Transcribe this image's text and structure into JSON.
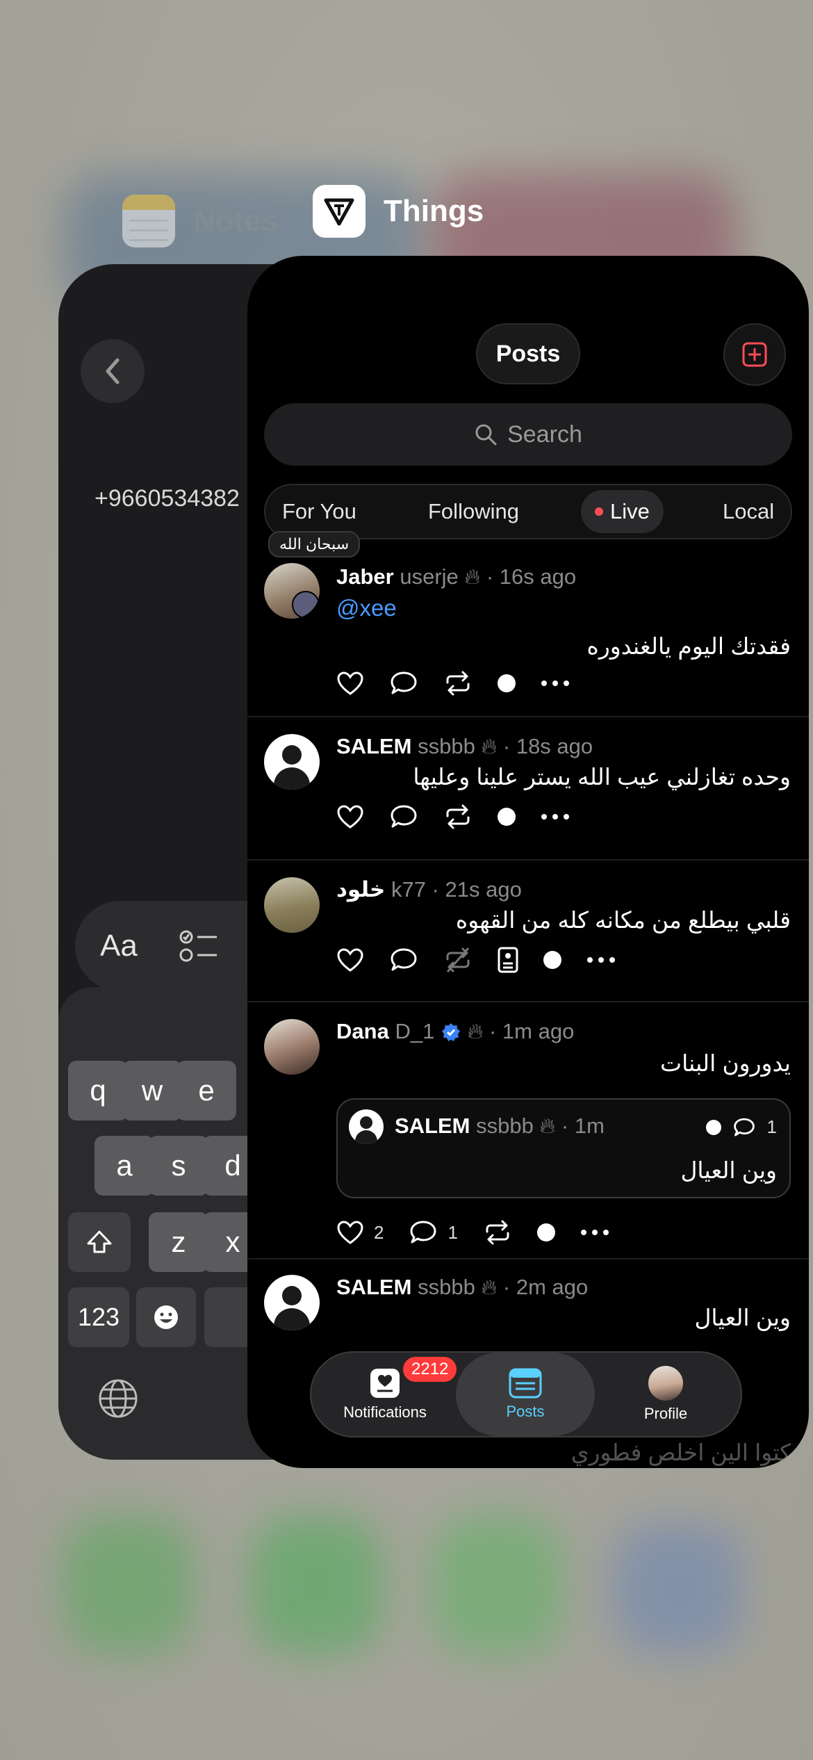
{
  "switcher": {
    "notes_app": {
      "name": "Notes",
      "icon": "notes-app-icon"
    },
    "things_app": {
      "name": "Things",
      "icon": "things-app-icon"
    }
  },
  "notes": {
    "phone_text": "+9660534382",
    "format_label": "Aa",
    "keyboard": {
      "row1": [
        "q",
        "w",
        "e"
      ],
      "row2": [
        "a",
        "s",
        "d"
      ],
      "row3": [
        "z",
        "x"
      ],
      "numbers_key": "123"
    }
  },
  "things": {
    "header": {
      "title": "Posts"
    },
    "search": {
      "placeholder": "Search"
    },
    "tabs": [
      {
        "label": "For You"
      },
      {
        "label": "Following"
      },
      {
        "label": "Live",
        "active": true
      },
      {
        "label": "Local"
      }
    ],
    "tooltip": "سبحان الله",
    "posts": [
      {
        "name": "Jaber",
        "handle": "userje",
        "time": "16s ago",
        "mention": "@xee",
        "text": "فقدتك اليوم يالغندوره"
      },
      {
        "name": "SALEM",
        "handle": "ssbbb",
        "time": "18s ago",
        "text": "وحده تغازلني عيب الله يستر علينا وعليها"
      },
      {
        "name": "خلود",
        "handle": "k77",
        "time": "21s ago",
        "text": "قلبي بيطلع من مكانه كله من القهوه"
      },
      {
        "name": "Dana",
        "handle": "D_1",
        "time": "1m ago",
        "text": "يدورون البنات",
        "likes": "2",
        "comments": "1",
        "quote": {
          "name": "SALEM",
          "handle": "ssbbb",
          "time": "1m",
          "comments": "1",
          "text": "وين العيال"
        }
      },
      {
        "name": "SALEM",
        "handle": "ssbbb",
        "time": "2m ago",
        "text": "وين العيال"
      },
      {
        "text": "كتوا الين اخلص فطوري"
      }
    ],
    "tabbar": {
      "notifications": {
        "label": "Notifications",
        "badge": "2212"
      },
      "posts": {
        "label": "Posts"
      },
      "profile": {
        "label": "Profile"
      }
    },
    "colors": {
      "accent": "#5ad0ff",
      "badge": "#ff3b3b",
      "live_dot": "#ff4d57",
      "mention": "#4a9bff",
      "add": "#ff4d57"
    }
  }
}
